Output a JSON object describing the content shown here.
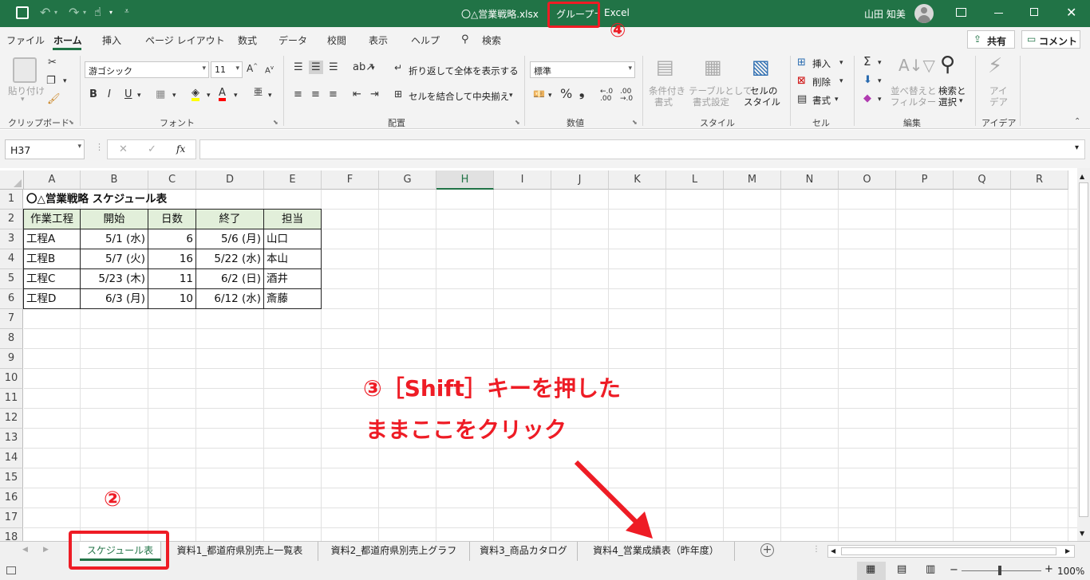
{
  "titlebar": {
    "filename": "〇△営業戦略.xlsx",
    "group_label": "グループ",
    "app_name": "Excel",
    "user_name": "山田 知美"
  },
  "menu": {
    "tabs": [
      "ファイル",
      "ホーム",
      "挿入",
      "ページ レイアウト",
      "数式",
      "データ",
      "校閲",
      "表示",
      "ヘルプ"
    ],
    "search_label": "検索",
    "share_label": "共有",
    "comment_label": "コメント"
  },
  "ribbon": {
    "clipboard": {
      "paste": "貼り付け",
      "group": "クリップボード"
    },
    "font": {
      "name": "游ゴシック",
      "size": "11",
      "group": "フォント"
    },
    "alignment": {
      "wrap": "折り返して全体を表示する",
      "merge": "セルを結合して中央揃え",
      "group": "配置"
    },
    "number": {
      "format": "標準",
      "group": "数値"
    },
    "styles": {
      "conditional_1": "条件付き",
      "conditional_2": "書式",
      "table_1": "テーブルとして",
      "table_2": "書式設定",
      "cell_1": "セルの",
      "cell_2": "スタイル",
      "group": "スタイル"
    },
    "cells": {
      "insert": "挿入",
      "delete": "削除",
      "format": "書式",
      "group": "セル"
    },
    "editing": {
      "sort_1": "並べ替えと",
      "sort_2": "フィルター",
      "find_1": "検索と",
      "find_2": "選択",
      "group": "編集"
    },
    "ideas": {
      "label_1": "アイ",
      "label_2": "デア",
      "group": "アイデア"
    }
  },
  "formula_bar": {
    "name_box": "H37",
    "fx": "fx",
    "value": ""
  },
  "columns": [
    "A",
    "B",
    "C",
    "D",
    "E",
    "F",
    "G",
    "H",
    "I",
    "J",
    "K",
    "L",
    "M",
    "N",
    "O",
    "P",
    "Q",
    "R"
  ],
  "rows": [
    "1",
    "2",
    "3",
    "4",
    "5",
    "6",
    "7",
    "8",
    "9",
    "10",
    "11",
    "12",
    "13",
    "14",
    "15",
    "16",
    "17",
    "18"
  ],
  "sheet": {
    "title": "〇△営業戦略 スケジュール表",
    "headers": [
      "作業工程",
      "開始",
      "日数",
      "終了",
      "担当"
    ],
    "data": [
      [
        "工程A",
        "5/1 (水)",
        "6",
        "5/6 (月)",
        "山口"
      ],
      [
        "工程B",
        "5/7 (火)",
        "16",
        "5/22 (水)",
        "本山"
      ],
      [
        "工程C",
        "5/23 (木)",
        "11",
        "6/2 (日)",
        "酒井"
      ],
      [
        "工程D",
        "6/3 (月)",
        "10",
        "6/12 (水)",
        "斎藤"
      ]
    ]
  },
  "sheet_tabs": [
    "スケジュール表",
    "資料1_都道府県別売上一覧表",
    "資料2_都道府県別売上グラフ",
    "資料3_商品カタログ",
    "資料4_営業成績表（昨年度）"
  ],
  "status": {
    "zoom": "100%"
  },
  "annotations": {
    "step2": "②",
    "step3_line1": "③［Shift］キーを押した",
    "step3_line2": "ままここをクリック",
    "step4": "④"
  },
  "colors": {
    "excel_green": "#217346",
    "annotation_red": "#ee1c25",
    "header_fill": "#e2efda"
  }
}
